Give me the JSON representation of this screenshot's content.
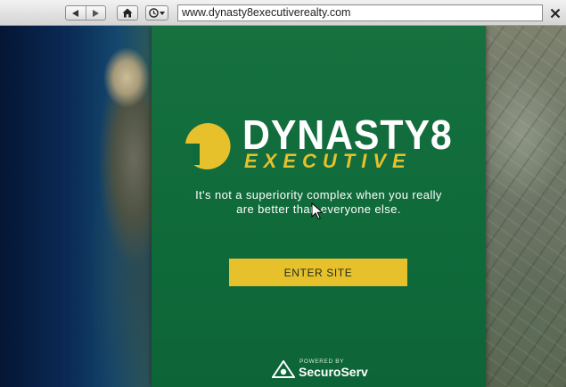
{
  "browser": {
    "url": "www.dynasty8executiverealty.com",
    "icons": {
      "back": "back-arrow-icon",
      "forward": "forward-arrow-icon",
      "home": "home-icon",
      "history": "history-clock-icon",
      "close": "close-icon"
    }
  },
  "site": {
    "brand_name": "DYNASTY8",
    "brand_sub": "EXECUTIVE",
    "tagline_line1": "It's not a superiority complex when you really",
    "tagline_line2": "are better than everyone else.",
    "enter_label": "ENTER SITE",
    "powered_by": "POWERED BY",
    "powered_name": "SecuroServ",
    "colors": {
      "panel_green": "#0f6a3a",
      "accent_yellow": "#e7c12c",
      "text": "#ffffff"
    }
  }
}
